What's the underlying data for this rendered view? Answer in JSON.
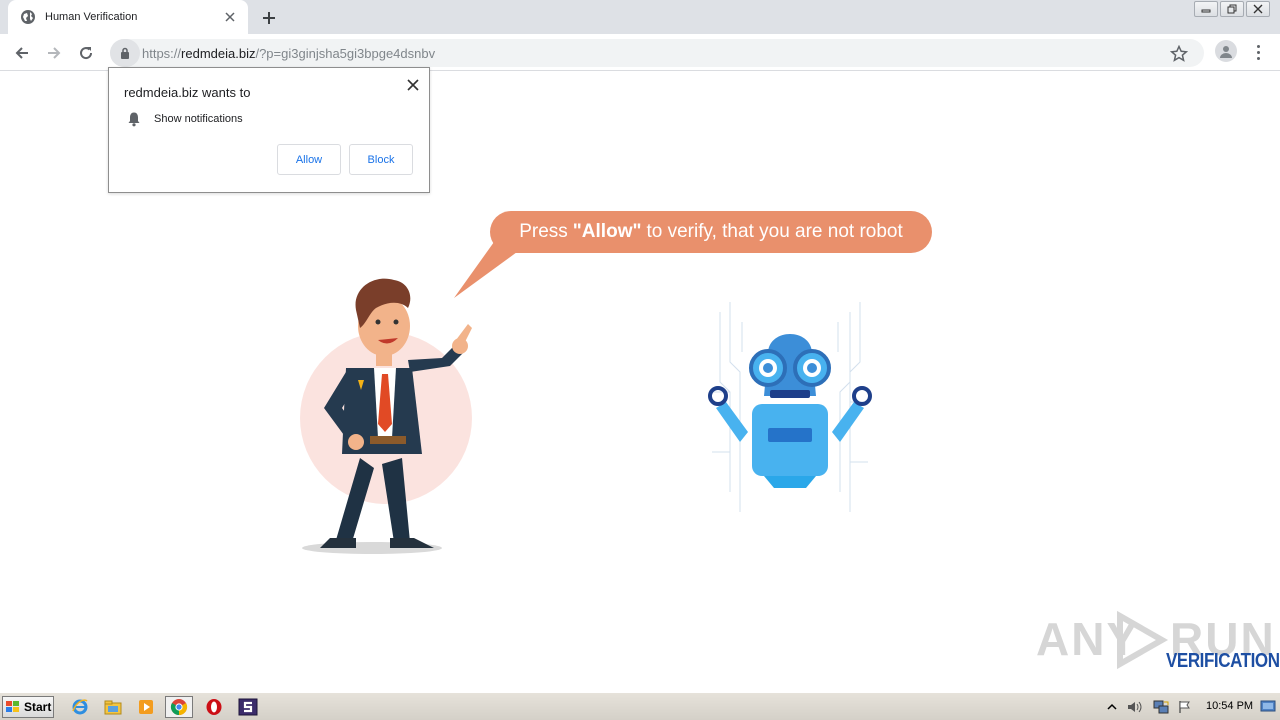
{
  "browser": {
    "tab": {
      "title": "Human Verification",
      "favicon": "globe-icon",
      "close_icon": "close-icon"
    },
    "new_tab_icon": "plus-icon",
    "window_controls": [
      "minimize-icon",
      "restore-icon",
      "close-icon"
    ],
    "address_bar": {
      "lock_icon": "lock-icon",
      "scheme": "https://",
      "host": "redmdeia.biz",
      "path": "/?p=gi3ginjsha5gi3bpge4dsnbv"
    },
    "bookmark_icon": "star-icon",
    "profile_icon": "user-icon",
    "menu_icon": "kebab-menu-icon"
  },
  "permission_prompt": {
    "title": "redmdeia.biz wants to",
    "item": "Show notifications",
    "item_icon": "bell-icon",
    "allow_label": "Allow",
    "block_label": "Block"
  },
  "page": {
    "bubble": {
      "prefix": "Press",
      "emphasis": "\"Allow\"",
      "suffix": "to verify, that you are not robot",
      "color": "#e9906c"
    },
    "watermark": {
      "brand_left": "ANY",
      "brand_right": "RUN",
      "subtitle": "VERIFICATION"
    }
  },
  "taskbar": {
    "start_label": "Start",
    "apps": [
      "ie-icon",
      "explorer-icon",
      "media-player-icon",
      "chrome-icon",
      "opera-icon",
      "app-s-icon"
    ],
    "tray": [
      "show-hidden-icon",
      "volume-icon",
      "network-icon",
      "action-center-flag-icon"
    ],
    "clock": "10:54 PM"
  }
}
